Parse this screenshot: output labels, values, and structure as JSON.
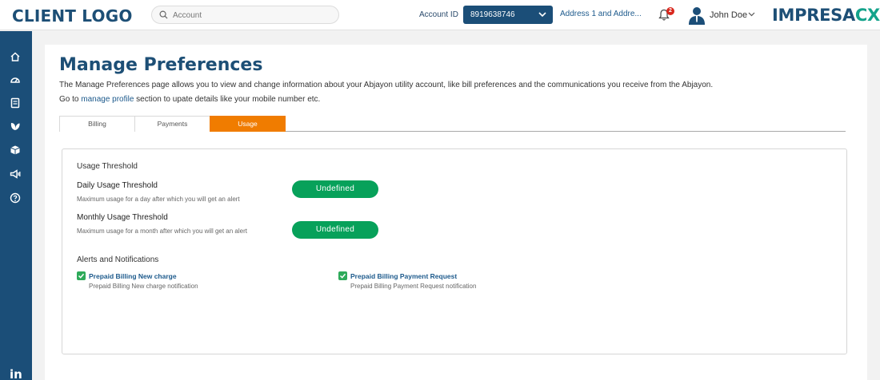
{
  "header": {
    "client_logo": "CLIENT LOGO",
    "search_placeholder": "Account",
    "account_id_label": "Account ID",
    "account_id_value": "8919638746",
    "address": "Address 1 and Addre...",
    "notification_count": "2",
    "user_name": "John Doe",
    "brand_main": "IMPRESA",
    "brand_accent": "CX"
  },
  "sidebar": {
    "items": [
      "home-icon",
      "dashboard-icon",
      "document-icon",
      "leaf-icon",
      "box-icon",
      "megaphone-icon",
      "help-icon"
    ],
    "footer": "in"
  },
  "page": {
    "title": "Manage Preferences",
    "description": "The Manage Preferences page allows you to view and change information about your Abjayon utility account, like bill preferences and the communications you receive from the Abjayon.",
    "profile_prefix": "Go to ",
    "profile_link": "manage profile",
    "profile_suffix": " section to upate details like your mobile number etc."
  },
  "tabs": [
    {
      "label": "Billing",
      "active": false
    },
    {
      "label": "Payments",
      "active": false
    },
    {
      "label": "Usage",
      "active": true
    }
  ],
  "usage": {
    "threshold_title": "Usage Threshold",
    "daily": {
      "title": "Daily Usage Threshold",
      "subtitle": "Maximum usage for a day after which you will get an alert",
      "value": "Undefined"
    },
    "monthly": {
      "title": "Monthly Usage Threshold",
      "subtitle": "Maximum usage for a month after which you will get an alert",
      "value": "Undefined"
    },
    "alerts_title": "Alerts and Notifications",
    "alerts": [
      {
        "label": "Prepaid Billing New charge",
        "description": "Prepaid Billing New charge notification",
        "checked": true
      },
      {
        "label": "Prepaid Billing Payment Request",
        "description": "Prepaid Billing Payment Request notification",
        "checked": true
      }
    ]
  },
  "colors": {
    "primary": "#1b4e78",
    "accent_tab": "#f07c00",
    "pill_green": "#07a15a",
    "checkbox_green": "#2eaa5a",
    "brand_teal": "#14a38b"
  }
}
